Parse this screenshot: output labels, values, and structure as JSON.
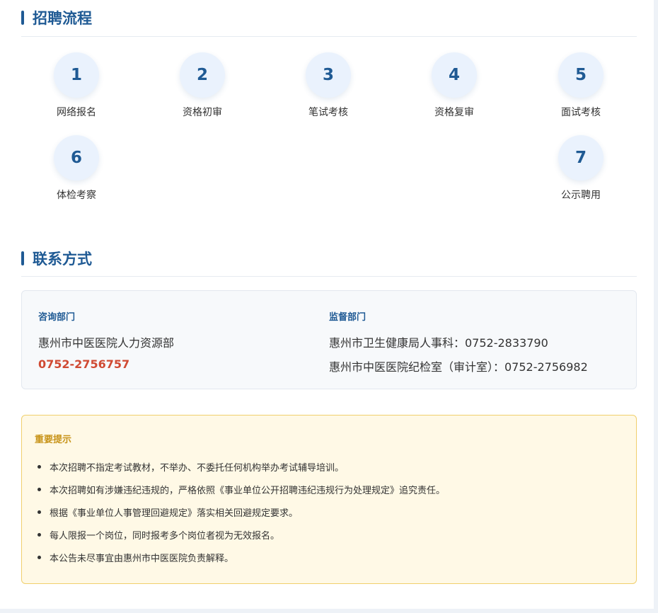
{
  "process": {
    "title": "招聘流程",
    "steps": [
      {
        "number": "1",
        "label": "网络报名"
      },
      {
        "number": "2",
        "label": "资格初审"
      },
      {
        "number": "3",
        "label": "笔试考核"
      },
      {
        "number": "4",
        "label": "资格复审"
      },
      {
        "number": "5",
        "label": "面试考核"
      },
      {
        "number": "6",
        "label": "体检考察"
      },
      {
        "number": "7",
        "label": "公示聘用"
      }
    ]
  },
  "contact": {
    "title": "联系方式",
    "consult": {
      "heading": "咨询部门",
      "department": "惠州市中医医院人力资源部",
      "phone": "0752-2756757"
    },
    "supervise": {
      "heading": "监督部门",
      "lines": [
        "惠州市卫生健康局人事科：0752-2833790",
        "惠州市中医医院纪检室（审计室）：0752-2756982"
      ]
    }
  },
  "notice": {
    "title": "重要提示",
    "items": [
      "本次招聘不指定考试教材，不举办、不委托任何机构举办考试辅导培训。",
      "本次招聘如有涉嫌违纪违规的，严格依照《事业单位公开招聘违纪违规行为处理规定》追究责任。",
      "根据《事业单位人事管理回避规定》落实相关回避规定要求。",
      "每人限报一个岗位，同时报考多个岗位者视为无效报名。",
      "本公告未尽事宜由惠州市中医医院负责解释。"
    ]
  },
  "colors": {
    "accent": "#1f5a94",
    "phone": "#d04a33",
    "notice_title": "#c8941a",
    "notice_bg": "#fff9e6"
  }
}
